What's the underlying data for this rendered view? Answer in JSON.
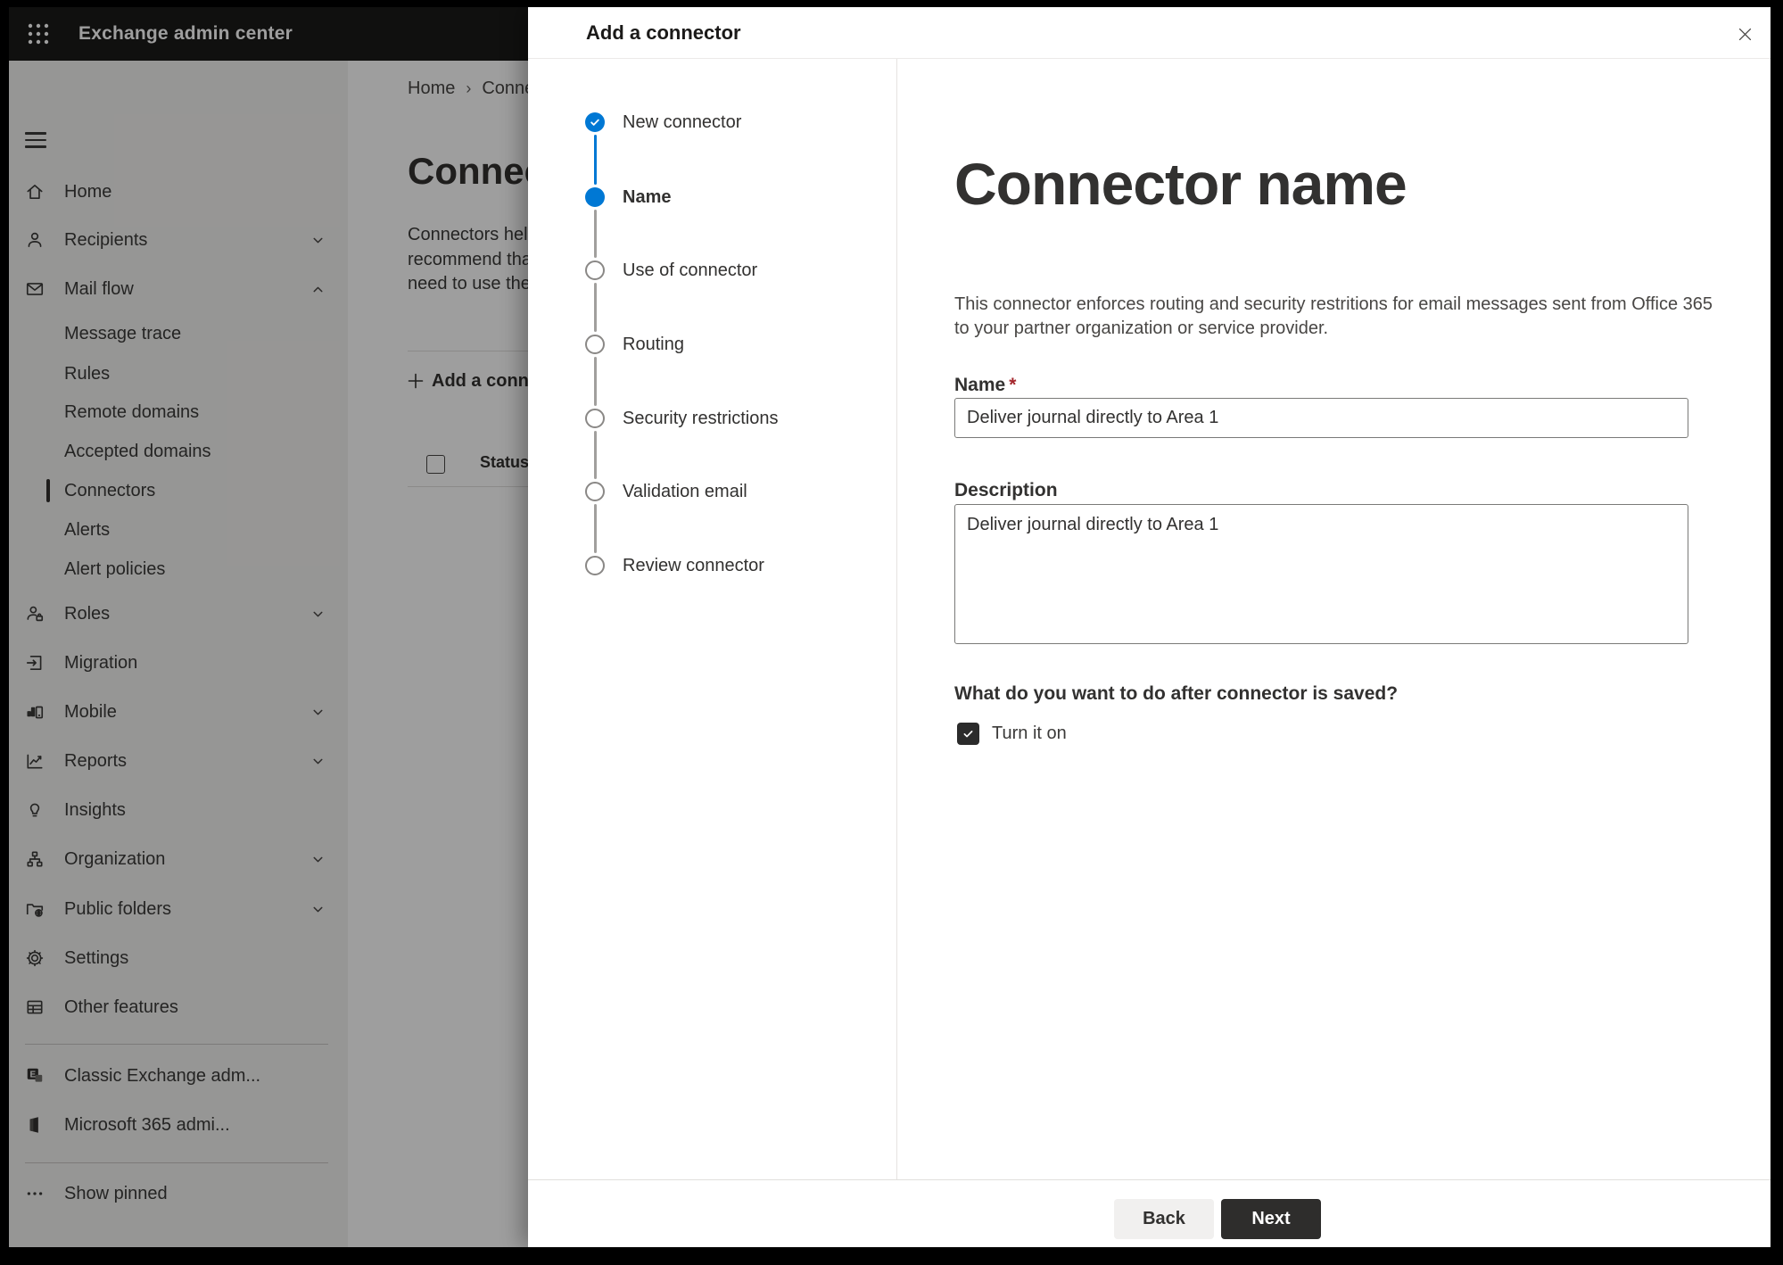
{
  "topbar": {
    "title": "Exchange admin center"
  },
  "sidebar": {
    "items": [
      {
        "label": "Home"
      },
      {
        "label": "Recipients"
      },
      {
        "label": "Mail flow"
      },
      {
        "label": "Message trace"
      },
      {
        "label": "Rules"
      },
      {
        "label": "Remote domains"
      },
      {
        "label": "Accepted domains"
      },
      {
        "label": "Connectors"
      },
      {
        "label": "Alerts"
      },
      {
        "label": "Alert policies"
      },
      {
        "label": "Roles"
      },
      {
        "label": "Migration"
      },
      {
        "label": "Mobile"
      },
      {
        "label": "Reports"
      },
      {
        "label": "Insights"
      },
      {
        "label": "Organization"
      },
      {
        "label": "Public folders"
      },
      {
        "label": "Settings"
      },
      {
        "label": "Other features"
      },
      {
        "label": "Classic Exchange adm..."
      },
      {
        "label": "Microsoft 365 admi..."
      },
      {
        "label": "Show pinned"
      }
    ]
  },
  "page": {
    "breadcrumb": {
      "home": "Home",
      "separator": "›",
      "current": "Conne"
    },
    "title": "Connec",
    "paragraph_lines": {
      "l1": "Connectors help",
      "l2": "recommend that",
      "l3": "need to use ther"
    },
    "add_button_label": "Add a conn",
    "table": {
      "status_header": "Status"
    }
  },
  "dialog": {
    "title": "Add a connector",
    "steps": [
      {
        "label": "New connector",
        "state": "done"
      },
      {
        "label": "Name",
        "state": "current"
      },
      {
        "label": "Use of connector",
        "state": "upcoming"
      },
      {
        "label": "Routing",
        "state": "upcoming"
      },
      {
        "label": "Security restrictions",
        "state": "upcoming"
      },
      {
        "label": "Validation email",
        "state": "upcoming"
      },
      {
        "label": "Review connector",
        "state": "upcoming"
      }
    ],
    "content": {
      "heading": "Connector name",
      "description": "This connector enforces routing and security restritions for email messages sent from Office 365 to your partner organization or service provider.",
      "name_label": "Name",
      "required_mark": "*",
      "name_value": "Deliver journal directly to Area 1",
      "description_label": "Description",
      "description_value": "Deliver journal directly to Area 1",
      "after_save_question": "What do you want to do after connector is saved?",
      "turn_on_label": "Turn it on"
    },
    "footer": {
      "back_label": "Back",
      "next_label": "Next"
    }
  },
  "colors": {
    "accent": "#0078d4",
    "topbar": "#1b1a19"
  }
}
